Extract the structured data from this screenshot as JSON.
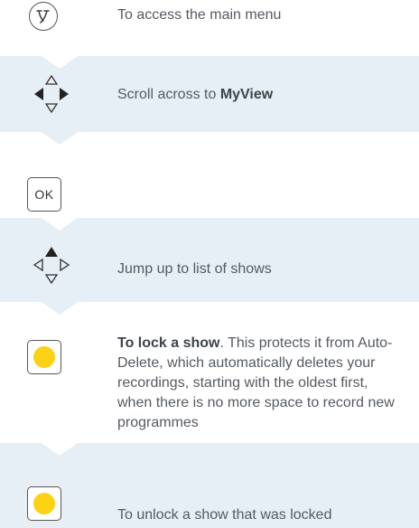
{
  "steps": [
    {
      "icon": "menu-button-icon",
      "text": "To access the main menu"
    },
    {
      "icon": "dpad-left-right-icon",
      "text_prefix": "Scroll across to ",
      "text_bold": "MyView"
    },
    {
      "icon": "ok-button-icon",
      "button_label": "OK",
      "text": ""
    },
    {
      "icon": "dpad-up-icon",
      "text": "Jump up to list of shows"
    },
    {
      "icon": "yellow-button-icon",
      "text_bold": "To lock a show",
      "text_rest": ". This protects it from Auto-Delete, which automatically deletes your recordings, starting with the oldest first, when there is no more space to record new programmes"
    },
    {
      "icon": "yellow-button-icon",
      "text": "To unlock a show that was locked"
    }
  ],
  "colors": {
    "band_blue": "#e6eef6",
    "yellow": "#fcd116",
    "text": "#555b62"
  }
}
